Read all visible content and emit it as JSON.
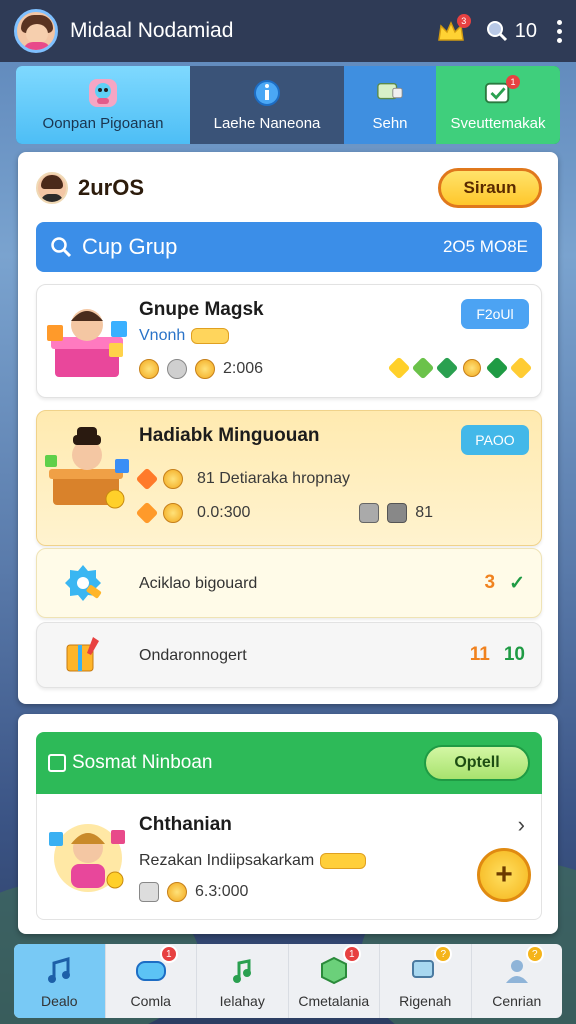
{
  "header": {
    "username": "Midaal Nodamiad",
    "notif_count": "3",
    "search_count": "10"
  },
  "tabs": [
    {
      "label": "Oonpan Pigoanan",
      "icon": "character-icon"
    },
    {
      "label": "Laehe Naneona",
      "icon": "info-icon"
    },
    {
      "label": "Sehn",
      "icon": "chat-icon"
    },
    {
      "label": "Sveuttemakak",
      "icon": "message-alert-icon",
      "badge": "1"
    }
  ],
  "main": {
    "count": "2urOS",
    "action_button": "Siraun",
    "search": {
      "label": "Cup Grup",
      "count": "2O5 MO8E"
    },
    "items": [
      {
        "title": "Gnupe Magsk",
        "subtitle": "Vnonh",
        "tag": "F2oUl",
        "stat_value": "2:006"
      },
      {
        "title": "Hadiabk Minguouan",
        "tag": "PAOO",
        "line1": "81 Detiaraka hropnay",
        "line2": "0.0:300",
        "line2_right": "81"
      },
      {
        "label": "Aciklao bigouard",
        "right_a": "3",
        "right_b": "✓"
      },
      {
        "label": "Ondaronnogert",
        "right_a": "11",
        "right_b": "10"
      }
    ]
  },
  "social": {
    "title": "Sosmat Ninboan",
    "button": "Optell",
    "entry": {
      "name": "Chthanian",
      "desc": "Rezakan Indiipsakarkam",
      "value": "6.3:000"
    }
  },
  "bottom_nav": [
    {
      "label": "Dealo",
      "icon": "music-icon",
      "active": true
    },
    {
      "label": "Comla",
      "icon": "controller-icon",
      "badge": "1"
    },
    {
      "label": "Ielahay",
      "icon": "music-note-icon"
    },
    {
      "label": "Cmetalania",
      "icon": "cube-icon",
      "badge": "1"
    },
    {
      "label": "Rigenah",
      "icon": "chat-bubble-icon",
      "badge": "?"
    },
    {
      "label": "Cenrian",
      "icon": "profile-icon",
      "badge": "?"
    }
  ]
}
